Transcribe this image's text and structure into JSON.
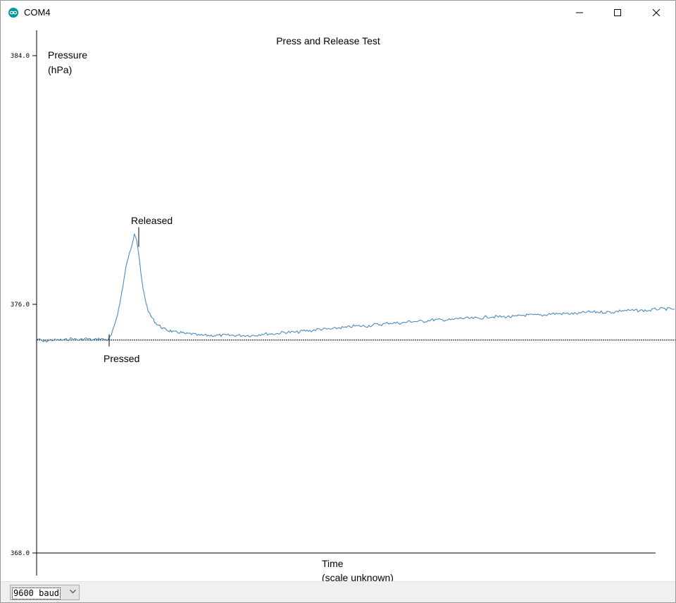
{
  "window": {
    "title": "COM4",
    "app_icon": "arduino-infinity-icon",
    "controls": [
      "minimize-icon",
      "maximize-icon",
      "close-icon"
    ]
  },
  "plot": {
    "title": "Press and Release Test",
    "y_label_line1": "Pressure",
    "y_label_line2": "(hPa)",
    "x_label_line1": "Time",
    "x_label_line2": "(scale unknown)",
    "annotation_pressed": "Pressed",
    "annotation_released": "Released",
    "y_ticks": [
      "384.0",
      "376.0",
      "368.0"
    ],
    "line_color": "#4a8cc2"
  },
  "chart_data": {
    "type": "line",
    "title": "Press and Release Test",
    "xlabel": "Time (scale unknown)",
    "ylabel": "Pressure (hPa)",
    "ylim": [
      368.0,
      384.0
    ],
    "y_ticks": [
      384.0,
      376.0,
      368.0
    ],
    "x": [
      0,
      10,
      20,
      30,
      40,
      50,
      60,
      70,
      80,
      90,
      100,
      103,
      106,
      109,
      112,
      115,
      118,
      121,
      124,
      127,
      130,
      133,
      136,
      139,
      142,
      145,
      148,
      151,
      154,
      157,
      160,
      163,
      166,
      169,
      172,
      175,
      178,
      181,
      184,
      187,
      190,
      195,
      200,
      205,
      210,
      215,
      220,
      230,
      240,
      250,
      260,
      270,
      280,
      290,
      300,
      310,
      320,
      330,
      340,
      350,
      360,
      370,
      380,
      390,
      400,
      410,
      420,
      430,
      440,
      450,
      460,
      470,
      480,
      490,
      500,
      510,
      520,
      530,
      540,
      550,
      560,
      570,
      580,
      590,
      600,
      610,
      620,
      630,
      640,
      650,
      660,
      670,
      680,
      690,
      700,
      710,
      720,
      730,
      740,
      750,
      760,
      770,
      780,
      790,
      800,
      810,
      820,
      830,
      840,
      850,
      860,
      870,
      880,
      890,
      900,
      906
    ],
    "values": [
      374.9,
      374.8,
      374.85,
      374.85,
      374.85,
      374.9,
      374.85,
      374.9,
      374.85,
      374.9,
      374.85,
      374.9,
      375.0,
      375.2,
      375.45,
      375.7,
      376.0,
      376.4,
      376.8,
      377.2,
      377.5,
      377.7,
      378.0,
      378.3,
      378.1,
      377.6,
      377.0,
      376.5,
      376.2,
      375.9,
      375.7,
      375.6,
      375.5,
      375.4,
      375.35,
      375.3,
      375.25,
      375.2,
      375.2,
      375.15,
      375.15,
      375.1,
      375.1,
      375.1,
      375.05,
      375.05,
      375.05,
      375.0,
      375.0,
      375.0,
      375.0,
      375.0,
      375.0,
      375.0,
      375.0,
      375.0,
      375.05,
      375.05,
      375.05,
      375.1,
      375.1,
      375.1,
      375.15,
      375.15,
      375.2,
      375.2,
      375.2,
      375.25,
      375.25,
      375.3,
      375.3,
      375.3,
      375.35,
      375.35,
      375.4,
      375.4,
      375.4,
      375.45,
      375.45,
      375.45,
      375.5,
      375.5,
      375.5,
      375.5,
      375.55,
      375.55,
      375.55,
      375.55,
      375.6,
      375.6,
      375.6,
      375.6,
      375.6,
      375.65,
      375.65,
      375.65,
      375.65,
      375.7,
      375.7,
      375.7,
      375.7,
      375.7,
      375.75,
      375.75,
      375.75,
      375.75,
      375.75,
      375.8,
      375.8,
      375.8,
      375.8,
      375.8,
      375.85,
      375.85,
      375.85,
      375.85
    ],
    "reference_line": 374.85,
    "annotations": [
      {
        "text": "Pressed",
        "x": 103
      },
      {
        "text": "Released",
        "x": 145
      }
    ],
    "grid": false,
    "legend": "none"
  },
  "footer": {
    "baud_value": "9600 baud",
    "dropdown_icon": "chevron-down-icon"
  }
}
